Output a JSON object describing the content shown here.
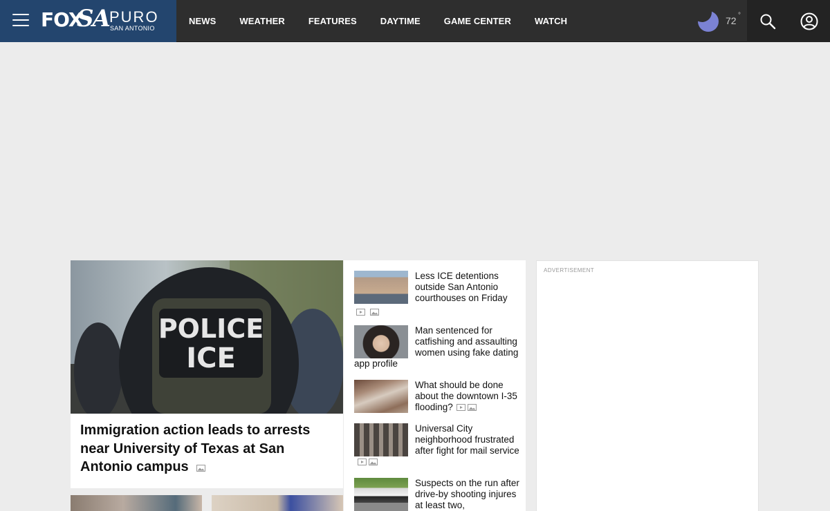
{
  "brand": {
    "fox": "FOX",
    "sa": "SA",
    "puro": "PURO",
    "subtitle": "SAN ANTONIO"
  },
  "nav": [
    "NEWS",
    "WEATHER",
    "FEATURES",
    "DAYTIME",
    "GAME CENTER",
    "WATCH"
  ],
  "weather": {
    "temperature": "72",
    "degree": "°",
    "icon": "moon-icon"
  },
  "colors": {
    "header": "#2e2e2e",
    "brand_bg": "#23456e",
    "moon": "#7b82d3",
    "page_bg": "#ececec"
  },
  "feature": {
    "title": "Immigration action leads to arrests near University of Texas at San Antonio campus",
    "image_text_line1": "POLICE",
    "image_text_line2": "ICE"
  },
  "stories": [
    {
      "headline": "Less ICE detentions outside San Antonio courthouses on Friday",
      "video": true,
      "gallery": true
    },
    {
      "headline": "Man sentenced for catfishing and assaulting women using fake dating app profile",
      "video": false,
      "gallery": false
    },
    {
      "headline": "What should be done about the downtown I-35 flooding?",
      "video": true,
      "gallery": true
    },
    {
      "headline": "Universal City neighborhood frustrated after fight for mail service",
      "video": true,
      "gallery": true
    },
    {
      "headline": "Suspects on the run after drive-by shooting injures at least two,",
      "video": false,
      "gallery": false
    }
  ],
  "ad": {
    "label": "ADVERTISEMENT"
  }
}
